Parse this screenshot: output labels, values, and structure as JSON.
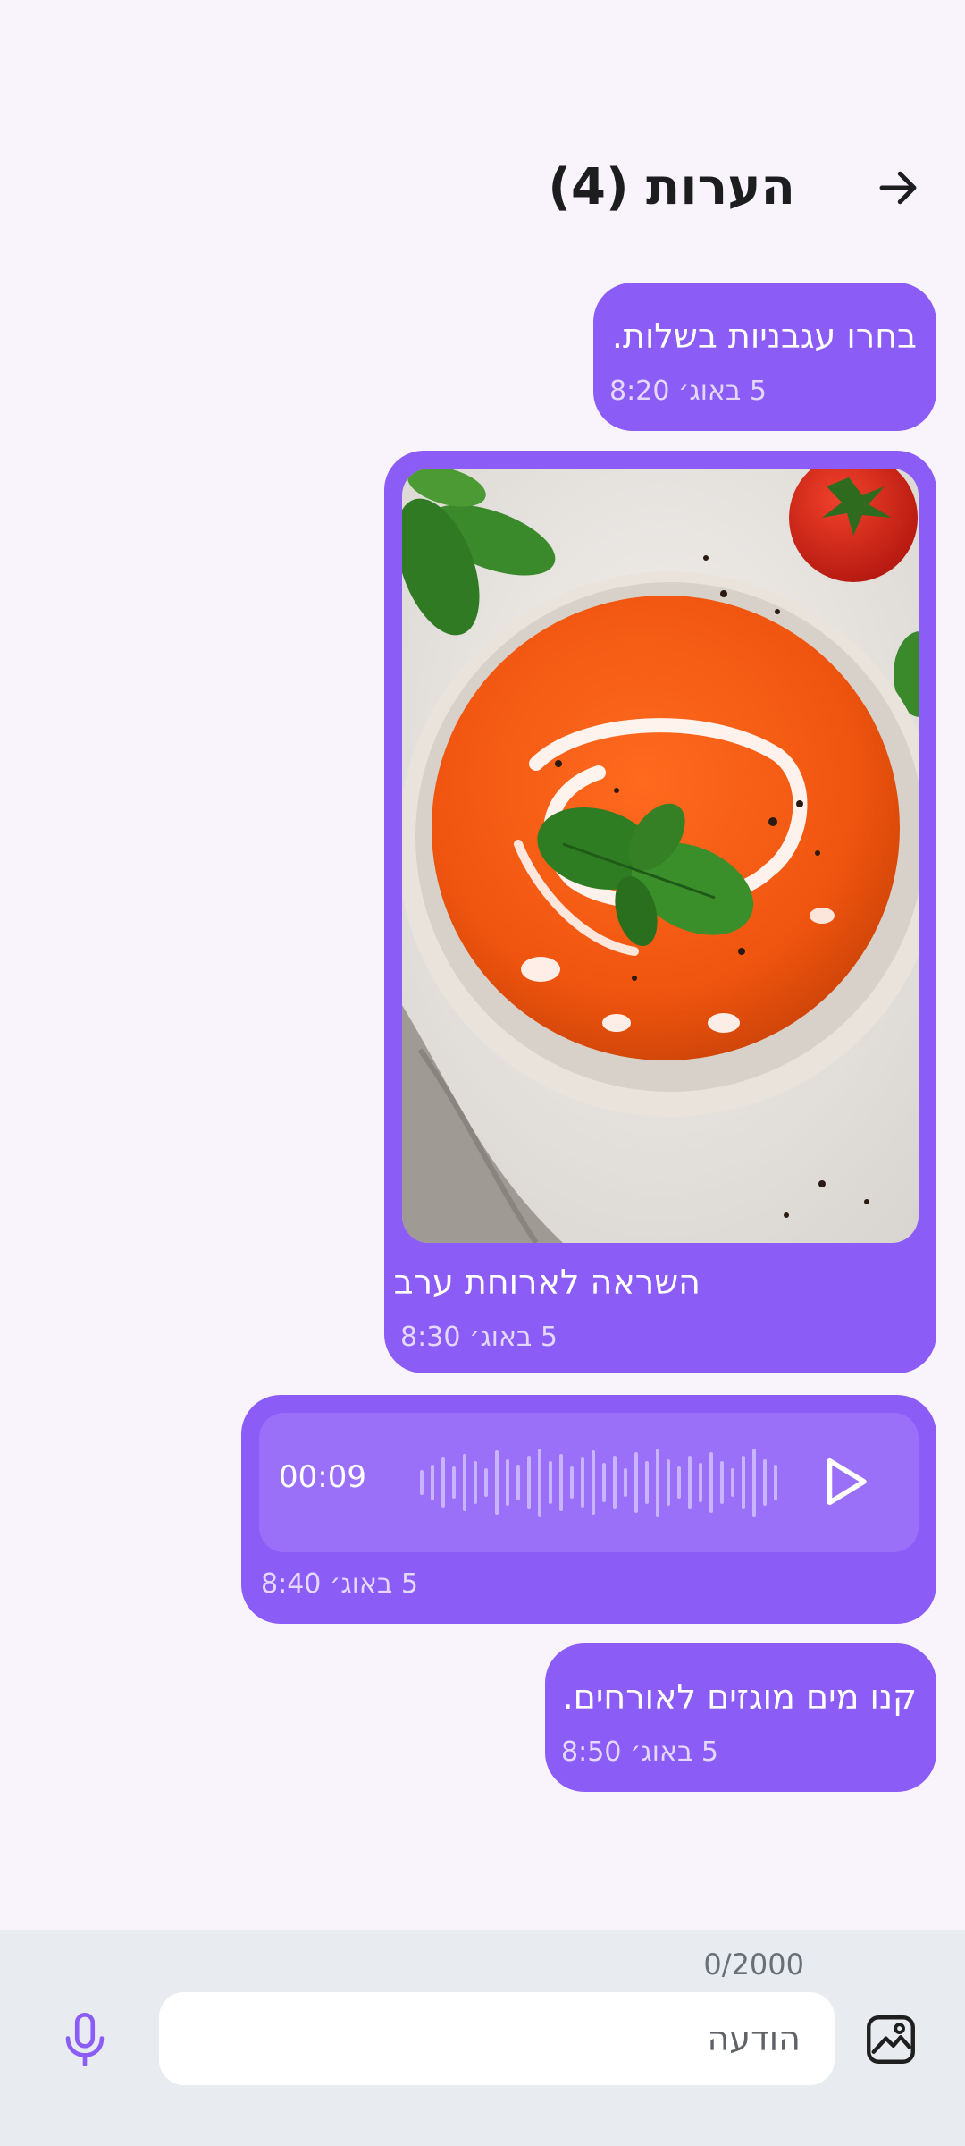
{
  "header": {
    "title": "הערות (4)",
    "back_icon": "arrow-right-icon"
  },
  "colors": {
    "background": "#f9f4fc",
    "bubble": "#8b5cf6",
    "composer": "#e8ecf1",
    "mic_icon": "#8b5cf6"
  },
  "messages": [
    {
      "type": "text",
      "text": "בחרו עגבניות בשלות.",
      "time": "5 באוג׳ 8:20"
    },
    {
      "type": "image",
      "image_icon": "tomato-soup-photo",
      "caption": "השראה לארוחת ערב",
      "time": "5 באוג׳ 8:30"
    },
    {
      "type": "audio",
      "duration": "00:09",
      "play_icon": "play-icon",
      "time": "5 באוג׳ 8:40"
    },
    {
      "type": "text",
      "text": "קנו מים מוגזים לאורחים.",
      "time": "5 באוג׳ 8:50"
    }
  ],
  "composer": {
    "char_counter": "0/2000",
    "placeholder": "הודעה",
    "value": "",
    "mic_icon": "microphone-icon",
    "gallery_icon": "image-gallery-icon"
  }
}
